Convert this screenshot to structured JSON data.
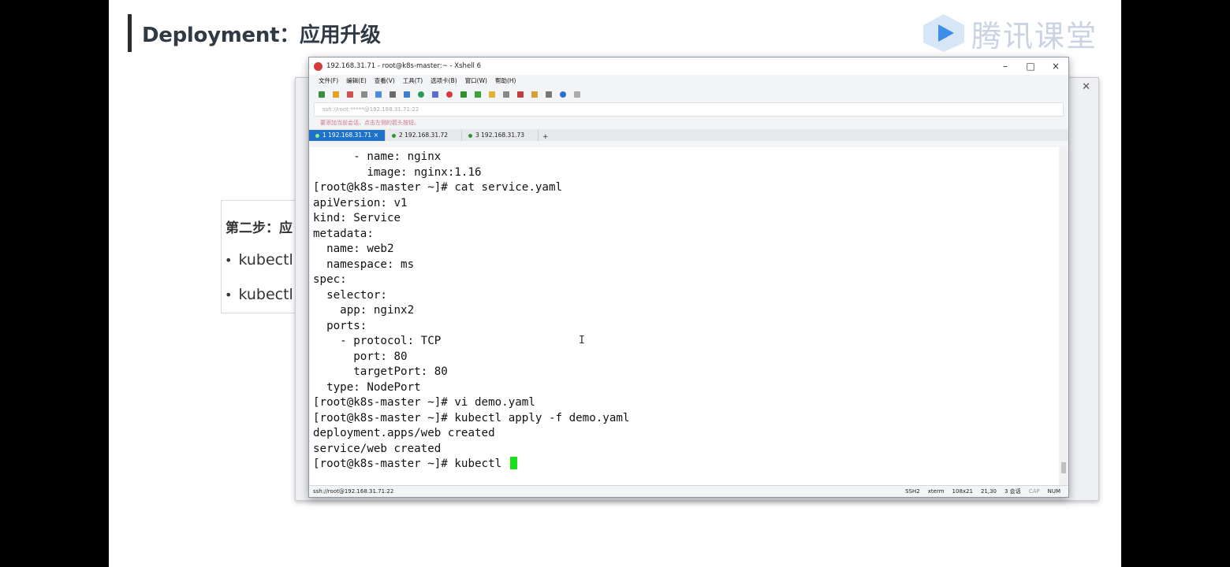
{
  "slide": {
    "title": "Deployment：应用升级",
    "logo_text": "腾讯课堂",
    "card_title": "第二步：应",
    "bullets": [
      "kubectl",
      "kubectl"
    ]
  },
  "window": {
    "title": "192.168.31.71 - root@k8s-master:~ - Xshell 6",
    "menu": [
      "文件(F)",
      "编辑(E)",
      "查看(V)",
      "工具(T)",
      "选项卡(B)",
      "窗口(W)",
      "帮助(H)"
    ],
    "address": "ssh://root:*****@192.168.31.71:22",
    "hint": "要添加当前会话，点击左侧的箭头按钮。",
    "tabs": [
      {
        "label": "1 192.168.31.71",
        "close": "×"
      },
      {
        "label": "2 192.168.31.72"
      },
      {
        "label": "3 192.168.31.73"
      }
    ],
    "tab_add": "+",
    "controls": {
      "minimize": "–",
      "maximize": "□",
      "close": "×"
    }
  },
  "terminal": {
    "lines": [
      "      - name: nginx",
      "        image: nginx:1.16",
      "[root@k8s-master ~]# cat service.yaml",
      "apiVersion: v1",
      "kind: Service",
      "metadata:",
      "  name: web2",
      "  namespace: ms",
      "spec:",
      "  selector:",
      "    app: nginx2",
      "  ports:",
      "    - protocol: TCP",
      "      port: 80",
      "      targetPort: 80",
      "  type: NodePort",
      "[root@k8s-master ~]# vi demo.yaml",
      "[root@k8s-master ~]# kubectl apply -f demo.yaml",
      "deployment.apps/web created",
      "service/web created"
    ],
    "prompt_line": "[root@k8s-master ~]# kubectl "
  },
  "status": {
    "connection": "ssh://root@192.168.31.71:22",
    "protocol": "SSH2",
    "term": "xterm",
    "size": "108x21",
    "cursor_pos": "21,30",
    "sessions": "3 会话",
    "caps": "CAP",
    "num": "NUM"
  }
}
